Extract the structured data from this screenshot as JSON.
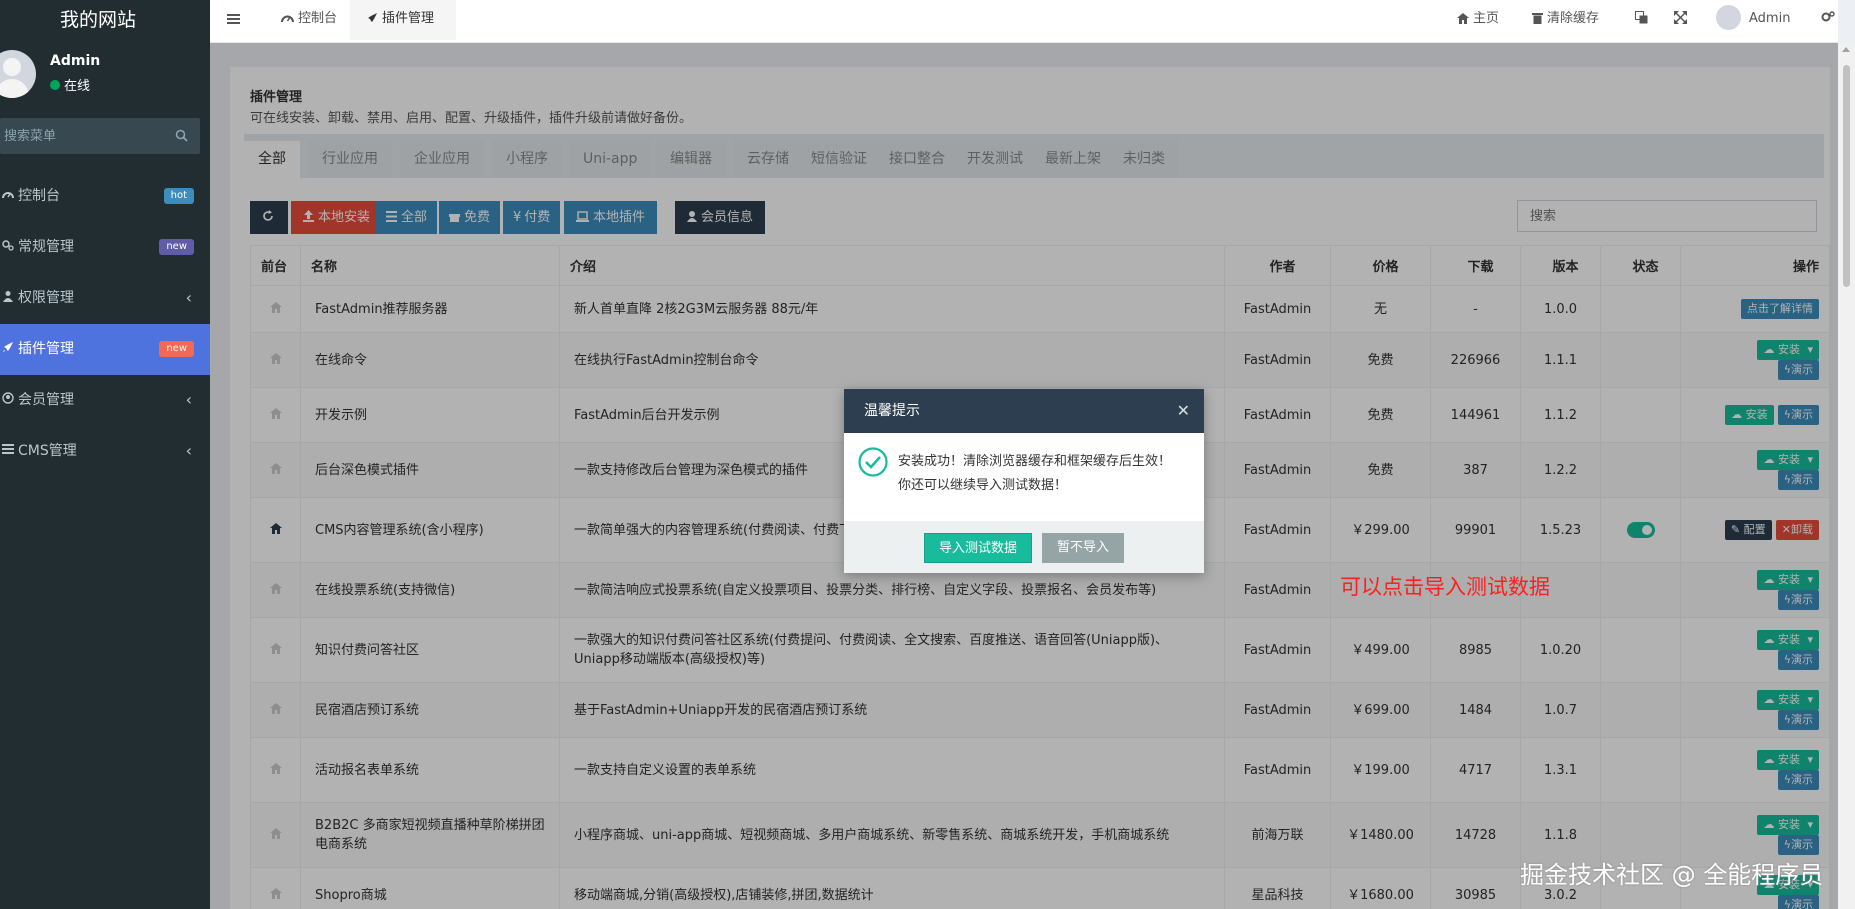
{
  "sidebar": {
    "brand": "我的网站",
    "user": {
      "name": "Admin",
      "status": "在线"
    },
    "search_placeholder": "搜索菜单",
    "items": [
      {
        "label": "控制台",
        "badge": "hot",
        "badge_color": "#3c8dbc"
      },
      {
        "label": "常规管理",
        "badge": "new",
        "badge_color": "#605ca8"
      },
      {
        "label": "权限管理",
        "chevron": "‹"
      },
      {
        "label": "插件管理",
        "badge": "new",
        "badge_color": "#f56954"
      },
      {
        "label": "会员管理",
        "chevron": "‹"
      },
      {
        "label": "CMS管理",
        "chevron": "‹"
      }
    ]
  },
  "topbar": {
    "tabs": [
      "控制台",
      "插件管理"
    ],
    "home": "主页",
    "clear_cache": "清除缓存",
    "admin": "Admin"
  },
  "page": {
    "title": "插件管理",
    "subtitle": "可在线安装、卸载、禁用、启用、配置、升级插件，插件升级前请做好备份。",
    "tabs": [
      "全部",
      "行业应用",
      "企业应用",
      "小程序",
      "Uni-app",
      "编辑器",
      "云存储",
      "短信验证",
      "接口整合",
      "开发测试",
      "最新上架",
      "未归类"
    ],
    "toolbar": {
      "local_install": "本地安装",
      "all": "全部",
      "free": "免费",
      "paid": "付费",
      "local_plugins": "本地插件",
      "member_info": "会员信息",
      "search_placeholder": "搜索"
    },
    "headers": [
      "前台",
      "名称",
      "介绍",
      "作者",
      "价格",
      "下载",
      "版本",
      "状态",
      "操作"
    ],
    "rows": [
      {
        "name": "FastAdmin推荐服务器",
        "intro": "新人首单直降 2核2G3M云服务器 88元/年",
        "author": "FastAdmin",
        "price": "无",
        "price_class": "",
        "downloads": "-",
        "version": "1.0.0",
        "actions": "detail"
      },
      {
        "name": "在线命令",
        "intro": "在线执行FastAdmin控制台命令",
        "author": "FastAdmin",
        "price": "免费",
        "price_class": "green",
        "downloads": "226966",
        "version": "1.1.1",
        "actions": "install2"
      },
      {
        "name": "开发示例",
        "intro": "FastAdmin后台开发示例",
        "author": "FastAdmin",
        "price": "免费",
        "price_class": "green",
        "downloads": "144961",
        "version": "1.1.2",
        "actions": "install1"
      },
      {
        "name": "后台深色模式插件",
        "intro": "一款支持修改后台管理为深色模式的插件",
        "author": "FastAdmin",
        "price": "免费",
        "price_class": "green",
        "downloads": "387",
        "version": "1.2.2",
        "actions": "install2"
      },
      {
        "name": "CMS内容管理系统(含小程序)",
        "intro": "一款简单强大的内容管理系统(付费阅读、付费下载、Uniapp移动端版本(高级授权)等)",
        "author": "FastAdmin",
        "price": "￥299.00",
        "price_class": "red",
        "downloads": "99901",
        "version": "1.5.23",
        "actions": "installed"
      },
      {
        "name": "在线投票系统(支持微信)",
        "intro": "一款简洁响应式投票系统(自定义投票项目、投票分类、排行榜、自定义字段、投票报名、会员发布等)",
        "author": "FastAdmin",
        "price": "",
        "price_class": "",
        "downloads": "",
        "version": "",
        "actions": "install2"
      },
      {
        "name": "知识付费问答社区",
        "intro": "一款强大的知识付费问答社区系统(付费提问、付费阅读、全文搜索、百度推送、语音回答(Uniapp版)、Uniapp移动端版本(高级授权)等)",
        "author": "FastAdmin",
        "price": "￥499.00",
        "price_class": "red",
        "downloads": "8985",
        "version": "1.0.20",
        "actions": "install2"
      },
      {
        "name": "民宿酒店预订系统",
        "intro": "基于FastAdmin+Uniapp开发的民宿酒店预订系统",
        "author": "FastAdmin",
        "price": "￥699.00",
        "price_class": "red",
        "downloads": "1484",
        "version": "1.0.7",
        "actions": "install2"
      },
      {
        "name": "活动报名表单系统",
        "intro": "一款支持自定义设置的表单系统",
        "author": "FastAdmin",
        "price": "￥199.00",
        "price_class": "red",
        "downloads": "4717",
        "version": "1.3.1",
        "actions": "install2"
      },
      {
        "name": "B2B2C 多商家短视频直播种草阶梯拼团电商系统",
        "intro": "小程序商城、uni-app商城、短视频商城、多用户商城系统、新零售系统、商城系统开发，手机商城系统",
        "author": "前海万联",
        "price": "￥1480.00",
        "price_class": "red",
        "downloads": "14728",
        "version": "1.1.8",
        "actions": "install2"
      },
      {
        "name": "Shopro商城",
        "intro": "移动端商城,分销(高级授权),店铺装修,拼团,数据统计",
        "author": "星品科技",
        "price": "￥1680.00",
        "price_class": "red",
        "downloads": "30985",
        "version": "3.0.2",
        "actions": "install2"
      }
    ],
    "action_labels": {
      "detail": "点击了解详情",
      "install": "安装",
      "demo": "演示",
      "config": "配置",
      "uninstall": "卸载"
    }
  },
  "modal": {
    "title": "温馨提示",
    "message": "安装成功！清除浏览器缓存和框架缓存后生效！你还可以继续导入测试数据！",
    "confirm": "导入测试数据",
    "cancel": "暂不导入"
  },
  "annotation": "可以点击导入测试数据",
  "watermark": "掘金技术社区 @ 全能程序员",
  "colors": {
    "sidebar": "#222d32",
    "active": "#4e73df",
    "primary": "#18bc9c",
    "danger": "#e74c3c",
    "info": "#3c8dbc",
    "dark": "#2c3e50"
  }
}
